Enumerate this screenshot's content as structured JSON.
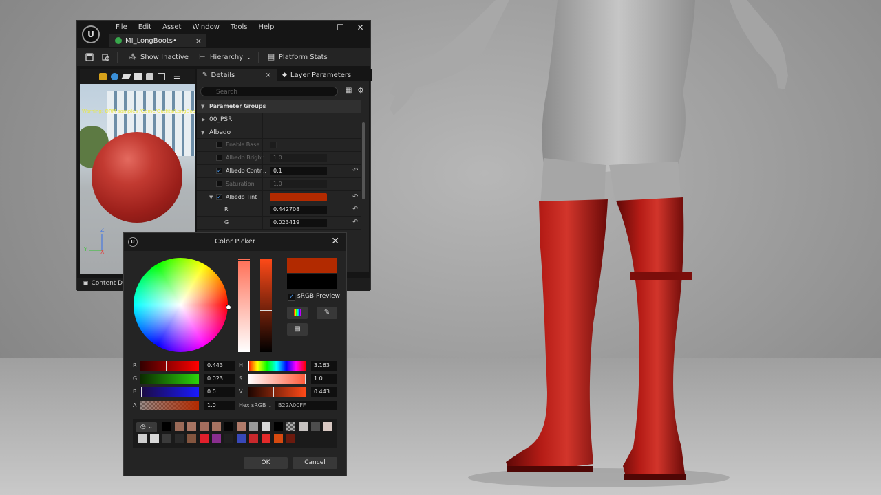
{
  "editor": {
    "menu": [
      "File",
      "Edit",
      "Asset",
      "Window",
      "Tools",
      "Help"
    ],
    "window_controls": {
      "minimize": "–",
      "maximize": "☐",
      "close": "✕"
    },
    "tab": {
      "label": "MI_LongBoots•",
      "close": "×"
    },
    "toolbar": {
      "show_inactive": "Show Inactive",
      "hierarchy": "Hierarchy",
      "platform_stats": "Platform Stats"
    },
    "viewport_warning": "Warning: ORM samples /Game/Outfits/LongBoo",
    "axis": {
      "z": "Z",
      "y": "Y",
      "x": "X"
    },
    "content_drawer": "Content Dra",
    "panel_tabs": {
      "details": "Details",
      "details_close": "×",
      "layer_parameters": "Layer Parameters"
    },
    "search_placeholder": "Search",
    "parameters": {
      "parameter_groups": "Parameter Groups",
      "group_psr": "00_PSR",
      "group_albedo": "Albedo",
      "enable_base": "Enable Base...",
      "albedo_brightness": "Albedo Bright...",
      "albedo_brightness_val": "1.0",
      "albedo_contrast": "Albedo Contr...",
      "albedo_contrast_val": "0.1",
      "saturation": "Saturation",
      "saturation_val": "1.0",
      "albedo_tint": "Albedo Tint",
      "r_label": "R",
      "r_val": "0.442708",
      "g_label": "G",
      "g_val": "0.023419"
    }
  },
  "color_picker": {
    "title": "Color Picker",
    "close": "✕",
    "srgb_preview": "sRGB Preview",
    "sliders": {
      "r": {
        "label": "R",
        "value": "0.443"
      },
      "g": {
        "label": "G",
        "value": "0.023"
      },
      "b": {
        "label": "B",
        "value": "0.0"
      },
      "a": {
        "label": "A",
        "value": "1.0"
      },
      "h": {
        "label": "H",
        "value": "3.163"
      },
      "s": {
        "label": "S",
        "value": "1.0"
      },
      "v": {
        "label": "V",
        "value": "0.443"
      }
    },
    "hex_label": "Hex sRGB",
    "hex_value": "B22A00FF",
    "ok": "OK",
    "cancel": "Cancel",
    "current_color": "#b22a00"
  },
  "colors": {
    "accent": "#4da3ff",
    "tint": "#b22a00",
    "boot": "#9e1410"
  }
}
